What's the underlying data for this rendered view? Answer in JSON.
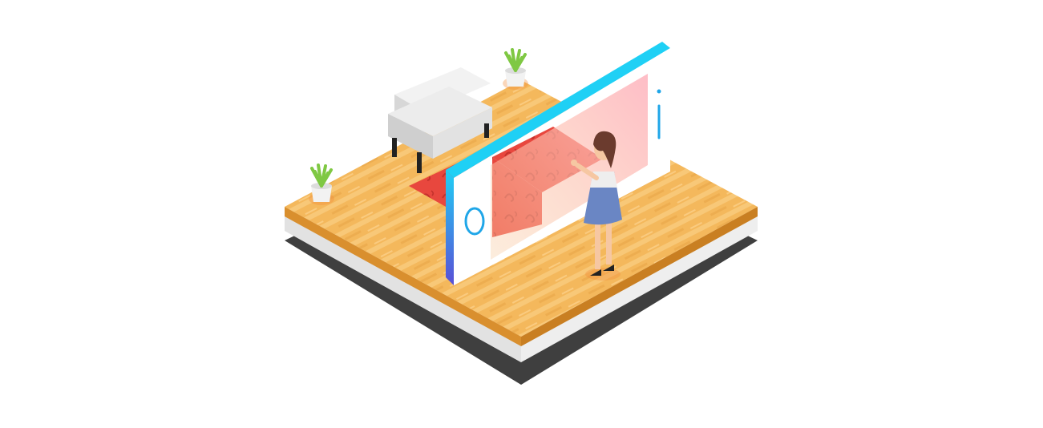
{
  "scene": {
    "description_free": true,
    "colors": {
      "background": "#ffffff",
      "floor_wood": "#f4b85c",
      "floor_wood_light": "#f9c978",
      "floor_edge": "#d98f2e",
      "base_white": "#eeeeee",
      "base_shadow": "#3f3f3f",
      "rug": "#e8473e",
      "rug_pattern": "#c9352f",
      "phone_frame_top": "#1fd0f5",
      "phone_frame_bottom": "#5a4fd6",
      "phone_screen": "#ffffff",
      "screen_tint": "#ffb3b8",
      "sofa": "#e9e9e9",
      "sofa_shade": "#cfcfcf",
      "plant_leaf": "#7fc843",
      "plant_pot": "#f2f2f2",
      "girl_dress": "#6a86c4",
      "girl_hair": "#6b3b2e",
      "girl_skin": "#f6c7a2"
    },
    "icons": [
      "sofa-icon",
      "plant-icon",
      "smartphone-icon",
      "rug-icon",
      "person-icon"
    ]
  }
}
